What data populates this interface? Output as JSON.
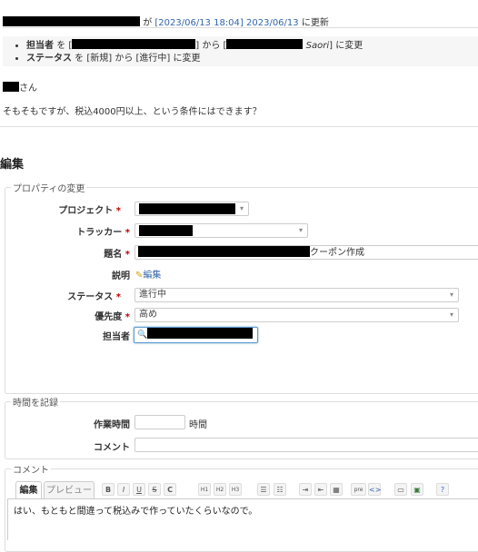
{
  "history": {
    "header_ga": "が",
    "datetime_link": "[2023/06/13 18:04]",
    "date_link": "2023/06/13",
    "updated_suffix": "に更新",
    "details": [
      {
        "field": "担当者",
        "wo": "を",
        "from_open": "[",
        "from_close": "] から [",
        "to_suffix": "Saori",
        "to_close": "] に変更"
      },
      {
        "field": "ステータス",
        "text": " を [新規] から [進行中] に変更"
      }
    ],
    "salutation": "さん",
    "note": "そもそもですが、税込4000円以上、という条件にはできます？"
  },
  "edit": {
    "title": "編集",
    "properties_legend": "プロパティの変更",
    "labels": {
      "project": "プロジェクト",
      "tracker": "トラッカー",
      "subject": "題名",
      "description": "説明",
      "status": "ステータス",
      "priority": "優先度",
      "assignee": "担当者"
    },
    "required_mark": "*",
    "subject_suffix": "クーポン作成",
    "description_edit": "編集",
    "status_value": "進行中",
    "priority_value": "高め",
    "time_legend": "時間を記録",
    "spent_time_label": "作業時間",
    "hours_unit": "時間",
    "comment_label": "コメント",
    "comment_legend": "コメント",
    "tab_edit": "編集",
    "tab_preview": "プレビュー",
    "toolbar": [
      "B",
      "I",
      "U",
      "S",
      "C",
      "H1",
      "H2",
      "H3",
      "ul",
      "ol",
      "in",
      "out",
      "tbl",
      "pre",
      "<>",
      "img",
      "link",
      "help"
    ],
    "comment_text": "はい、もともと間違って税込みで作っていたくらいなので。"
  }
}
